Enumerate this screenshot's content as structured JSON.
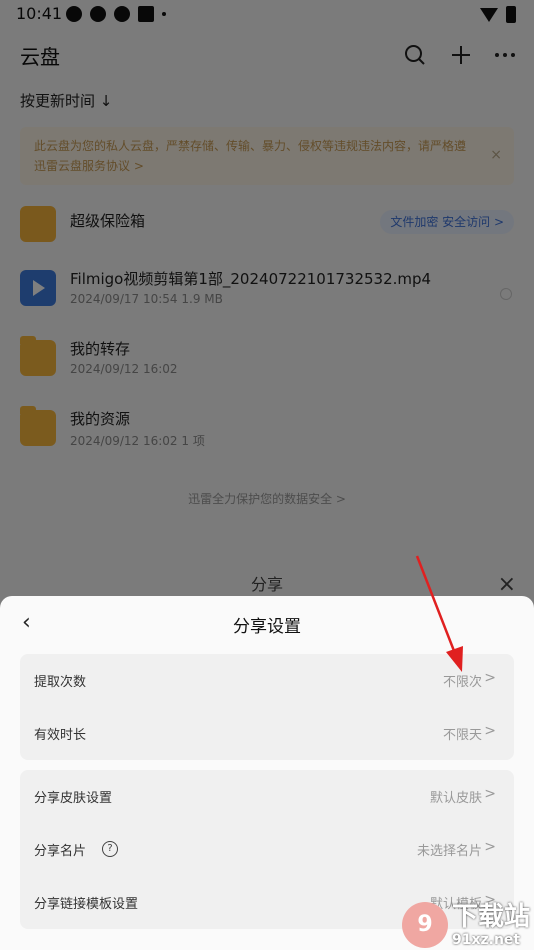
{
  "status_bar": {
    "time": "10:41"
  },
  "header": {
    "title": "云盘"
  },
  "sort_label": "按更新时间 ↓",
  "notice": {
    "text": "此云盘为您的私人云盘，严禁存储、传输、暴力、侵权等违规违法内容，请严格遵",
    "link": "迅雷云盘服务协议 >",
    "close": "×"
  },
  "files": [
    {
      "name": "超级保险箱",
      "meta": "",
      "tag": "文件加密 安全访问 >"
    },
    {
      "name": "Filmigo视频剪辑第1部_20240722101732532.mp4",
      "meta": "2024/09/17 10:54  1.9 MB"
    },
    {
      "name": "我的转存",
      "meta": "2024/09/12 16:02"
    },
    {
      "name": "我的资源",
      "meta": "2024/09/12 16:02  1 项"
    }
  ],
  "footer_note": "迅雷全力保护您的数据安全 >",
  "share_dialog": {
    "title": "分享",
    "close": "×"
  },
  "settings_sheet": {
    "back": "‹",
    "title": "分享设置",
    "group1": [
      {
        "label": "提取次数",
        "value": "不限次"
      },
      {
        "label": "有效时长",
        "value": "不限天"
      }
    ],
    "group2": [
      {
        "label": "分享皮肤设置",
        "value": "默认皮肤"
      },
      {
        "label": "分享名片",
        "value": "未选择名片",
        "help": "?"
      },
      {
        "label": "分享链接模板设置",
        "value": "默认模板"
      }
    ]
  },
  "watermark": {
    "badge": "9",
    "title": "下载站",
    "sub": "91xz.net"
  },
  "colors": {
    "accent": "#3f72d9",
    "annotation_arrow": "#e02020"
  }
}
